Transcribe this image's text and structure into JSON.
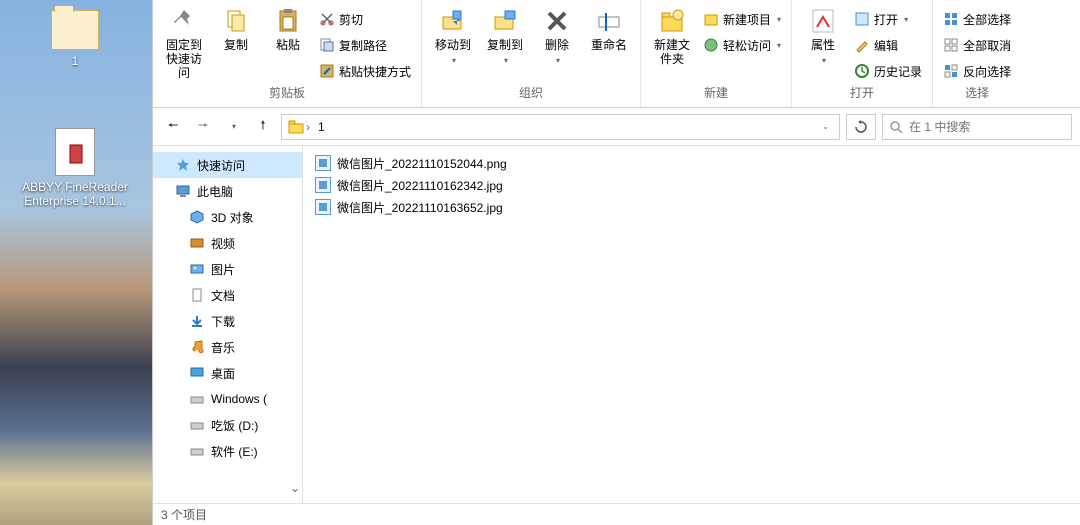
{
  "desktop": {
    "icons": [
      {
        "label": "1"
      },
      {
        "label": "ABBYY FineReader Enterprise 14.0.1..."
      }
    ]
  },
  "ribbon": {
    "pin": "固定到快速访问",
    "copy": "复制",
    "paste": "粘贴",
    "cut": "剪切",
    "copy_path": "复制路径",
    "paste_shortcut": "粘贴快捷方式",
    "move_to": "移动到",
    "copy_to": "复制到",
    "delete": "删除",
    "rename": "重命名",
    "new_folder": "新建文件夹",
    "new_item": "新建项目",
    "easy_access": "轻松访问",
    "properties": "属性",
    "open": "打开",
    "edit": "编辑",
    "history": "历史记录",
    "select_all": "全部选择",
    "select_none": "全部取消",
    "invert_selection": "反向选择",
    "group_clipboard": "剪贴板",
    "group_organize": "组织",
    "group_new": "新建",
    "group_open": "打开",
    "group_select": "选择"
  },
  "address": {
    "folder": "1",
    "search_placeholder": "在 1 中搜索"
  },
  "tree": {
    "quick_access": "快速访问",
    "this_pc": "此电脑",
    "objects_3d": "3D 对象",
    "videos": "视频",
    "pictures": "图片",
    "documents": "文档",
    "downloads": "下载",
    "music": "音乐",
    "desktop": "桌面",
    "windows": "Windows (",
    "drive_d": "吃饭 (D:)",
    "drive_e": "软件 (E:)"
  },
  "files": [
    {
      "name": "微信图片_20221110152044.png"
    },
    {
      "name": "微信图片_20221110162342.jpg"
    },
    {
      "name": "微信图片_20221110163652.jpg"
    }
  ],
  "status": {
    "items": "3 个项目"
  }
}
